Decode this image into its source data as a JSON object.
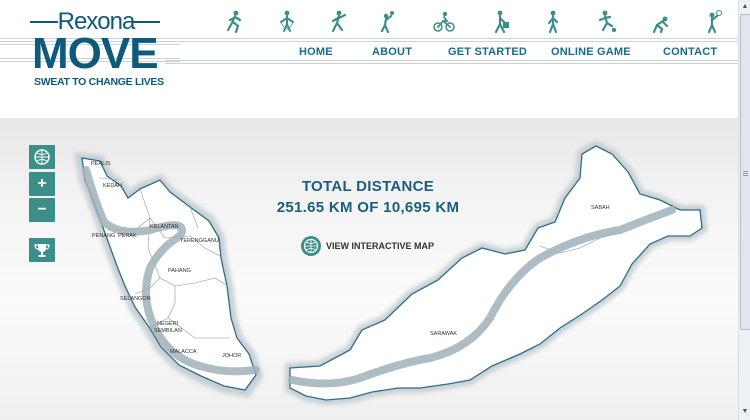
{
  "brand": {
    "name": "Rexona",
    "product": "MOVE",
    "tagline": "SWEAT TO CHANGE LIVES",
    "color": "#0f5a7a"
  },
  "nav": [
    {
      "label": "HOME"
    },
    {
      "label": "ABOUT"
    },
    {
      "label": "GET STARTED"
    },
    {
      "label": "ONLINE GAME"
    },
    {
      "label": "CONTACT"
    }
  ],
  "sport_icons": [
    "runner-icon",
    "skipping-rope-icon",
    "aerobics-icon",
    "volleyball-icon",
    "cyclist-icon",
    "walker-icon",
    "jogger-icon",
    "football-icon",
    "sprinter-icon",
    "badminton-icon"
  ],
  "map_controls": [
    {
      "name": "map-view-button",
      "icon": "globe-icon",
      "label": ""
    },
    {
      "name": "zoom-in-button",
      "icon": "plus-icon",
      "label": "+"
    },
    {
      "name": "zoom-out-button",
      "icon": "minus-icon",
      "label": "−"
    },
    {
      "name": "leaderboard-button",
      "icon": "trophy-icon",
      "label": ""
    }
  ],
  "progress": {
    "title": "TOTAL DISTANCE",
    "distance_text": "251.65 KM OF 10,695 KM",
    "covered_km": 251.65,
    "total_km": 10695
  },
  "interactive_map_link": "VIEW INTERACTIVE MAP",
  "regions": {
    "perlis": "PERLIS",
    "kedah": "KEDAH",
    "penang": "PENANG",
    "perak": "PERAK",
    "kelantan": "KELANTAN",
    "terengganu": "TERENGGANU",
    "pahang": "PAHANG",
    "selangor": "SELANGOR",
    "negeri": "NEGERI",
    "sembilan": "SEMBILAN",
    "malacca": "MALACCA",
    "johor": "JOHOR",
    "sarawak": "SARAWAK",
    "sabah": "SABAH"
  },
  "colors": {
    "accent": "#156c8c",
    "control_bg": "#3c8e8b",
    "route": "#9fb1b9",
    "land_outline": "#2f6d8a"
  }
}
